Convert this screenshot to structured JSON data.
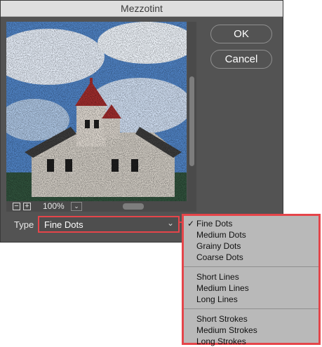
{
  "dialog": {
    "title": "Mezzotint",
    "ok_label": "OK",
    "cancel_label": "Cancel",
    "zoom": {
      "minus_label": "−",
      "plus_label": "+",
      "value": "100%",
      "dropdown_glyph": "⌄"
    },
    "type": {
      "label": "Type",
      "selected": "Fine Dots",
      "chevron": "⌄"
    }
  },
  "menu": {
    "check_glyph": "✓",
    "items": [
      "Fine Dots",
      "Medium Dots",
      "Grainy Dots",
      "Coarse Dots",
      "Short Lines",
      "Medium Lines",
      "Long Lines",
      "Short Strokes",
      "Medium Strokes",
      "Long Strokes"
    ]
  },
  "colors": {
    "highlight": "#e5454a",
    "dialog_bg": "#535353",
    "menu_bg": "#b9b9b9"
  }
}
